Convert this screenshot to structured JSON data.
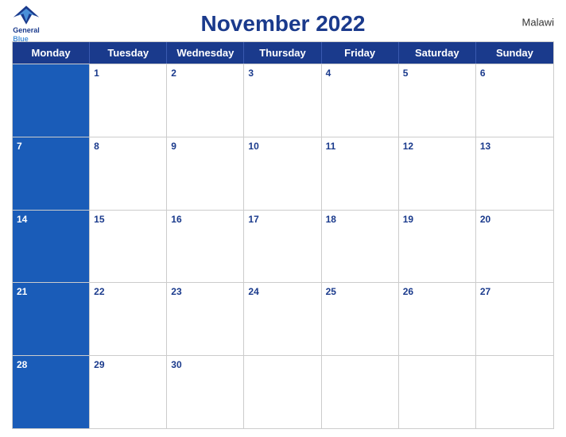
{
  "header": {
    "title": "November 2022",
    "country": "Malawi",
    "logo": {
      "line1": "General",
      "line2": "Blue"
    }
  },
  "days": [
    "Monday",
    "Tuesday",
    "Wednesday",
    "Thursday",
    "Friday",
    "Saturday",
    "Sunday"
  ],
  "weeks": [
    [
      null,
      1,
      2,
      3,
      4,
      5,
      6
    ],
    [
      7,
      8,
      9,
      10,
      11,
      12,
      13
    ],
    [
      14,
      15,
      16,
      17,
      18,
      19,
      20
    ],
    [
      21,
      22,
      23,
      24,
      25,
      26,
      27
    ],
    [
      28,
      29,
      30,
      null,
      null,
      null,
      null
    ]
  ]
}
